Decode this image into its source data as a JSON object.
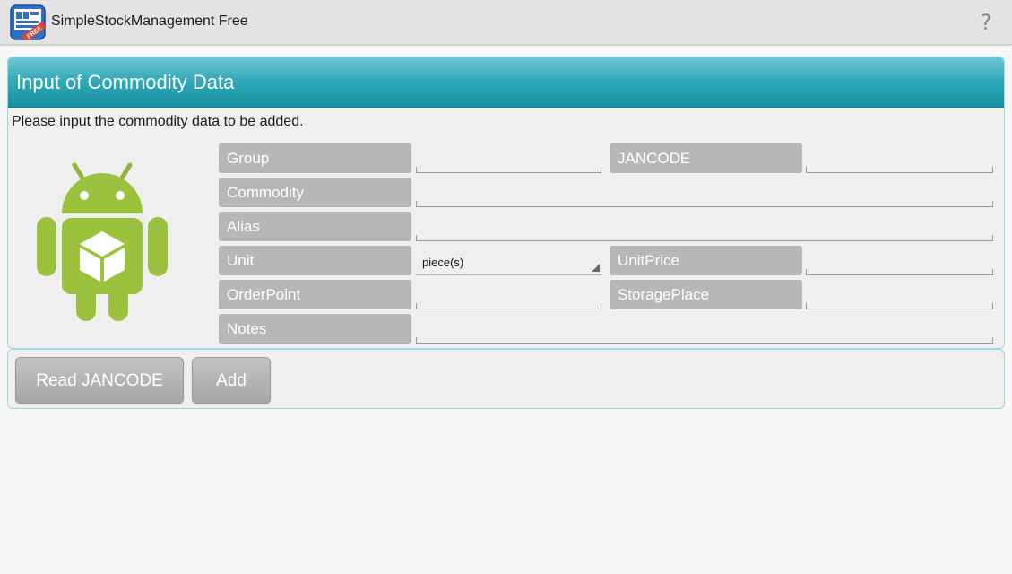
{
  "app": {
    "title": "SimpleStockManagement Free",
    "icon": "app-logo-icon",
    "badge_text": "FREE",
    "help_icon": "help-icon"
  },
  "panel": {
    "title": "Input of Commodity Data",
    "instruction": "Please input the commodity data to be added.",
    "image_icon": "android-box-icon"
  },
  "form": {
    "group_label": "Group",
    "group_value": "",
    "jancode_label": "JANCODE",
    "jancode_value": "",
    "commodity_label": "Commodity",
    "commodity_value": "",
    "alias_label": "Alias",
    "alias_value": "",
    "unit_label": "Unit",
    "unit_value": "piece(s)",
    "unitprice_label": "UnitPrice",
    "unitprice_value": "",
    "orderpoint_label": "OrderPoint",
    "orderpoint_value": "",
    "storageplace_label": "StoragePlace",
    "storageplace_value": "",
    "notes_label": "Notes",
    "notes_value": ""
  },
  "buttons": {
    "read_jancode": "Read JANCODE",
    "add": "Add"
  },
  "colors": {
    "header_accent": "#2fa7b8",
    "android_green": "#9bc23c",
    "label_gray": "#b7b7b7"
  }
}
